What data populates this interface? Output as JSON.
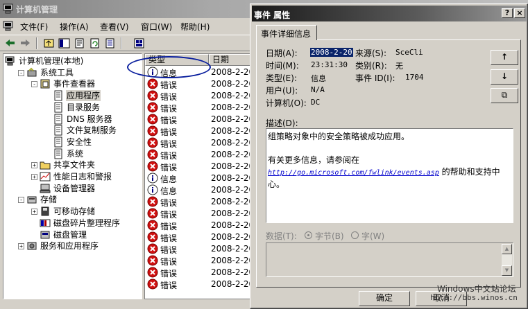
{
  "main_window": {
    "title": "计算机管理",
    "menu": [
      "文件(F)",
      "操作(A)",
      "查看(V)",
      "窗口(W)",
      "帮助(H)"
    ]
  },
  "tree": [
    {
      "label": "计算机管理(本地)",
      "depth": 0,
      "expander": "",
      "icon": "computer-icon"
    },
    {
      "label": "系统工具",
      "depth": 1,
      "expander": "-",
      "icon": "tools-icon"
    },
    {
      "label": "事件查看器",
      "depth": 2,
      "expander": "-",
      "icon": "event-viewer-icon"
    },
    {
      "label": "应用程序",
      "depth": 3,
      "expander": "",
      "icon": "log-icon",
      "selected": true
    },
    {
      "label": "目录服务",
      "depth": 3,
      "expander": "",
      "icon": "log-icon"
    },
    {
      "label": "DNS 服务器",
      "depth": 3,
      "expander": "",
      "icon": "log-icon"
    },
    {
      "label": "文件复制服务",
      "depth": 3,
      "expander": "",
      "icon": "log-icon"
    },
    {
      "label": "安全性",
      "depth": 3,
      "expander": "",
      "icon": "log-icon"
    },
    {
      "label": "系统",
      "depth": 3,
      "expander": "",
      "icon": "log-icon"
    },
    {
      "label": "共享文件夹",
      "depth": 2,
      "expander": "+",
      "icon": "folder-icon"
    },
    {
      "label": "性能日志和警报",
      "depth": 2,
      "expander": "+",
      "icon": "perf-icon"
    },
    {
      "label": "设备管理器",
      "depth": 2,
      "expander": "",
      "icon": "device-icon"
    },
    {
      "label": "存储",
      "depth": 1,
      "expander": "-",
      "icon": "storage-icon"
    },
    {
      "label": "可移动存储",
      "depth": 2,
      "expander": "+",
      "icon": "removable-icon"
    },
    {
      "label": "磁盘碎片整理程序",
      "depth": 2,
      "expander": "",
      "icon": "defrag-icon"
    },
    {
      "label": "磁盘管理",
      "depth": 2,
      "expander": "",
      "icon": "disk-icon"
    },
    {
      "label": "服务和应用程序",
      "depth": 1,
      "expander": "+",
      "icon": "services-icon"
    }
  ],
  "list": {
    "columns": [
      "类型",
      "日期"
    ],
    "rows": [
      {
        "type": "信息",
        "date": "2008-2-20",
        "kind": "info"
      },
      {
        "type": "错误",
        "date": "2008-2-20",
        "kind": "error"
      },
      {
        "type": "错误",
        "date": "2008-2-20",
        "kind": "error"
      },
      {
        "type": "错误",
        "date": "2008-2-20",
        "kind": "error"
      },
      {
        "type": "错误",
        "date": "2008-2-20",
        "kind": "error"
      },
      {
        "type": "错误",
        "date": "2008-2-20",
        "kind": "error"
      },
      {
        "type": "错误",
        "date": "2008-2-20",
        "kind": "error"
      },
      {
        "type": "错误",
        "date": "2008-2-20",
        "kind": "error"
      },
      {
        "type": "错误",
        "date": "2008-2-20",
        "kind": "error"
      },
      {
        "type": "信息",
        "date": "2008-2-20",
        "kind": "info"
      },
      {
        "type": "信息",
        "date": "2008-2-20",
        "kind": "info"
      },
      {
        "type": "错误",
        "date": "2008-2-20",
        "kind": "error"
      },
      {
        "type": "错误",
        "date": "2008-2-20",
        "kind": "error"
      },
      {
        "type": "错误",
        "date": "2008-2-20",
        "kind": "error"
      },
      {
        "type": "错误",
        "date": "2008-2-20",
        "kind": "error"
      },
      {
        "type": "错误",
        "date": "2008-2-20",
        "kind": "error"
      },
      {
        "type": "错误",
        "date": "2008-2-20",
        "kind": "error"
      },
      {
        "type": "错误",
        "date": "2008-2-20",
        "kind": "error"
      },
      {
        "type": "错误",
        "date": "2008-2-20",
        "kind": "error"
      }
    ]
  },
  "dialog": {
    "title": "事件 属性",
    "help_btn": "?",
    "close_btn": "×",
    "tab": "事件详细信息",
    "fields": {
      "date_label": "日期(A):",
      "date": "2008-2-20",
      "source_label": "来源(S):",
      "source": "SceCli",
      "time_label": "时间(M):",
      "time": "23:31:30",
      "category_label": "类别(R):",
      "category": "无",
      "type_label": "类型(E):",
      "type": "信息",
      "event_id_label": "事件 ID(I):",
      "event_id": "1704",
      "user_label": "用户(U):",
      "user": "N/A",
      "computer_label": "计算机(O):",
      "computer": "DC"
    },
    "nav": {
      "up": "↑",
      "down": "↓",
      "copy": "⧉"
    },
    "description_label": "描述(D):",
    "description": {
      "line1": "组策略对象中的安全策略被成功应用。",
      "line2": "有关更多信息，请参阅在",
      "link": "http://go.microsoft.com/fwlink/events.asp",
      "line3": "的帮助和支持中",
      "line4": "心。"
    },
    "data_label": "数据(T):",
    "radio_bytes": "字节(B)",
    "radio_words": "字(W)",
    "ok": "确定",
    "cancel": "取消"
  },
  "watermark": {
    "line1": "Windows中文站论坛",
    "line2": "http://bbs.winos.cn"
  }
}
